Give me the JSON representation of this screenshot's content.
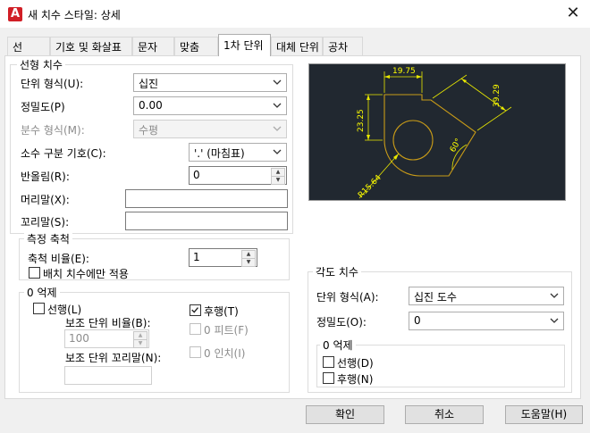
{
  "window": {
    "title": "새 치수 스타일: 상세",
    "app_icon_letter": "A",
    "close_glyph": "✕"
  },
  "tabs": [
    {
      "label": "선"
    },
    {
      "label": "기호 및 화살표"
    },
    {
      "label": "문자"
    },
    {
      "label": "맞춤"
    },
    {
      "label": "1차 단위"
    },
    {
      "label": "대체 단위"
    },
    {
      "label": "공차"
    }
  ],
  "linear": {
    "legend": "선형 치수",
    "unit_format_label": "단위 형식(U):",
    "unit_format_value": "십진",
    "precision_label": "정밀도(P)",
    "precision_value": "0.00",
    "fraction_label": "분수 형식(M):",
    "fraction_value": "수평",
    "decimal_sep_label": "소수 구분 기호(C):",
    "decimal_sep_value": "'.' (마침표)",
    "round_label": "반올림(R):",
    "round_value": "0",
    "prefix_label": "머리말(X):",
    "prefix_value": "",
    "suffix_label": "꼬리말(S):",
    "suffix_value": ""
  },
  "scale": {
    "legend": "측정 축척",
    "factor_label": "축척 비율(E):",
    "factor_value": "1",
    "layout_only_label": "배치 치수에만 적용",
    "layout_only_checked": false
  },
  "zero_linear": {
    "legend": "0 억제",
    "leading_label": "선행(L)",
    "leading_checked": false,
    "trailing_label": "후행(T)",
    "trailing_checked": true,
    "sub_factor_label": "보조 단위 비율(B):",
    "sub_factor_value": "100",
    "sub_suffix_label": "보조 단위 꼬리말(N):",
    "sub_suffix_value": "",
    "feet_label": "0 피트(F)",
    "inches_label": "0 인치(I)"
  },
  "angular": {
    "legend": "각도 치수",
    "unit_format_label": "단위 형식(A):",
    "unit_format_value": "십진 도수",
    "precision_label": "정밀도(O):",
    "precision_value": "0",
    "zero_legend": "0 억제",
    "leading_label": "선행(D)",
    "leading_checked": false,
    "trailing_label": "후행(N)",
    "trailing_checked": false
  },
  "preview": {
    "dims": [
      "19.75",
      "23.25",
      "39.29",
      "60°",
      "R15.64"
    ],
    "colors": {
      "bg": "#212830",
      "dim": "#ffff00",
      "geometry": "#c89b18"
    }
  },
  "buttons": {
    "ok": "확인",
    "cancel": "취소",
    "help": "도움말(H)"
  }
}
